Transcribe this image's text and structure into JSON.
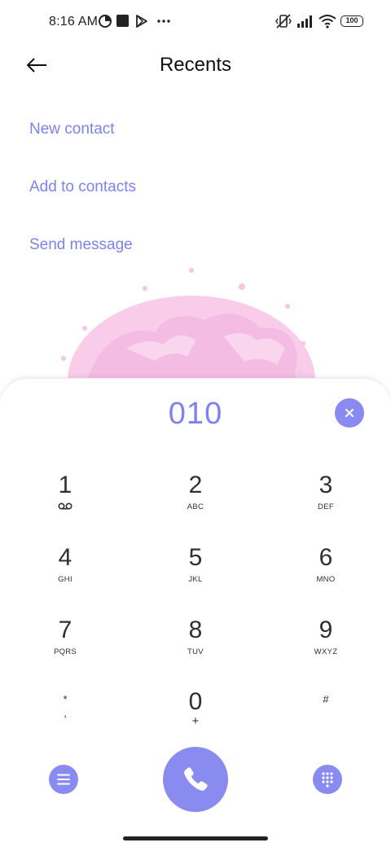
{
  "status_bar": {
    "time": "8:16 AM",
    "battery": "100",
    "icons": [
      "timer-icon",
      "square-notification-icon",
      "play-store-icon",
      "more-notifications-icon",
      "vibrate-mute-icon",
      "signal-icon",
      "wifi-icon",
      "battery-icon"
    ]
  },
  "header": {
    "title": "Recents",
    "back_icon": "arrow-left-icon"
  },
  "actions": [
    {
      "label": "New contact"
    },
    {
      "label": "Add to contacts"
    },
    {
      "label": "Send message"
    }
  ],
  "dialpad": {
    "number": "010",
    "clear_icon": "close-icon",
    "keys": [
      {
        "digit": "1",
        "letters": "",
        "icon": "voicemail-icon"
      },
      {
        "digit": "2",
        "letters": "ABC"
      },
      {
        "digit": "3",
        "letters": "DEF"
      },
      {
        "digit": "4",
        "letters": "GHI"
      },
      {
        "digit": "5",
        "letters": "JKL"
      },
      {
        "digit": "6",
        "letters": "MNO"
      },
      {
        "digit": "7",
        "letters": "PQRS"
      },
      {
        "digit": "8",
        "letters": "TUV"
      },
      {
        "digit": "9",
        "letters": "WXYZ"
      },
      {
        "digit": "*",
        "letters": ","
      },
      {
        "digit": "0",
        "letters": "+"
      },
      {
        "digit": "#",
        "letters": ""
      }
    ],
    "bottom_icons": [
      "menu-icon",
      "phone-icon",
      "dialpad-icon"
    ]
  },
  "colors": {
    "accent": "#8a8bf0",
    "link": "#7f82ee",
    "text": "#2d2f3a"
  }
}
